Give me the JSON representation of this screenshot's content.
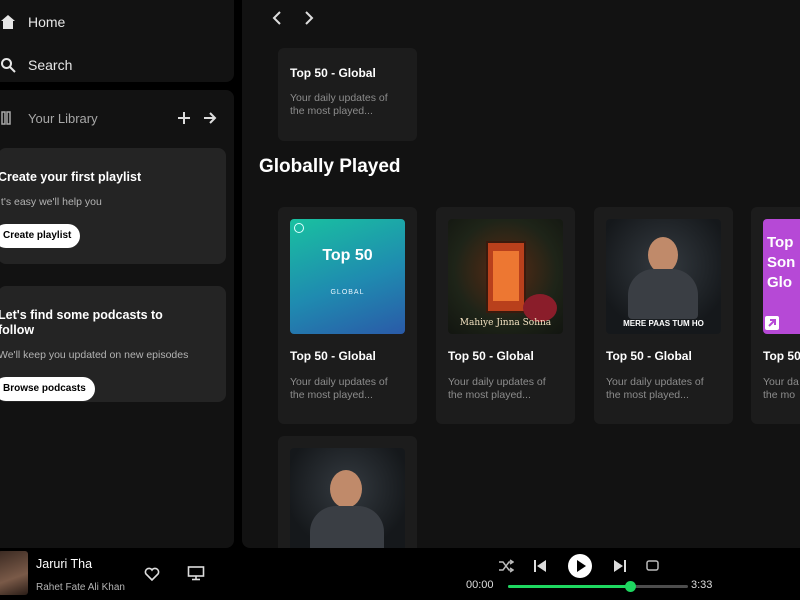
{
  "nav": {
    "home": "Home",
    "search": "Search"
  },
  "library": {
    "title": "Your Library",
    "create_playlist": {
      "heading": "Create your first playlist",
      "text": "It's easy we'll help you",
      "button": "Create playlist"
    },
    "podcasts": {
      "heading_line1": "Let's find some podcasts to",
      "heading_line2": "follow",
      "text": "We'll keep you updated on new episodes",
      "button": "Browse podcasts"
    }
  },
  "main": {
    "section_title": "Globally Played",
    "top_card": {
      "title": "Top 50 - Global",
      "desc_line1": "Your daily updates of",
      "desc_line2": "the most played..."
    },
    "cards": [
      {
        "title": "Top 50 - Global",
        "desc_line1": "Your daily updates of",
        "desc_line2": "the most played...",
        "art_text": "Top 50",
        "art_sub": "GLOBAL"
      },
      {
        "title": "Top 50 - Global",
        "desc_line1": "Your daily updates of",
        "desc_line2": "the most played...",
        "art_text": "Mahiye Jinna Sohna"
      },
      {
        "title": "Top 50 - Global",
        "desc_line1": "Your daily updates of",
        "desc_line2": "the most played...",
        "art_text": "MERE PAAS TUM HO"
      },
      {
        "title": "Top 50",
        "desc_line1": "Your da",
        "desc_line2": "the mo",
        "art_text": "Top Son Glo"
      }
    ]
  },
  "player": {
    "song": "Jaruri Tha",
    "artist": "Rahet Fate Ali Khan",
    "time_current": "00:00",
    "time_total": "3:33",
    "progress": 0.68
  },
  "colors": {
    "accent": "#1ed760",
    "panel": "#121212",
    "card": "#1c1c1c"
  }
}
